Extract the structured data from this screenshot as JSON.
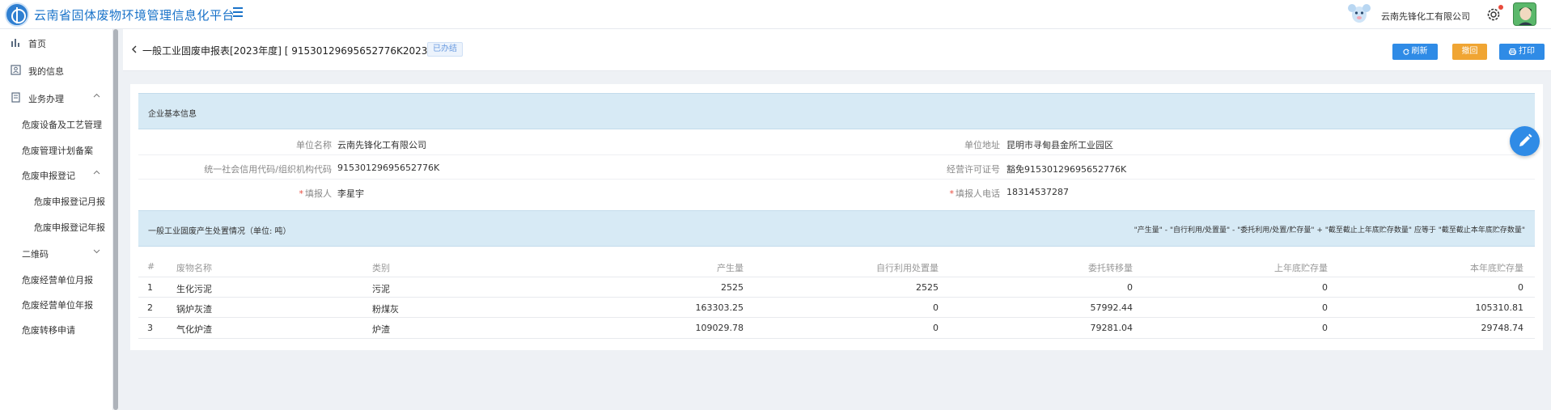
{
  "header": {
    "app_title": "云南省固体废物环境管理信息化平台",
    "company_name": "云南先锋化工有限公司"
  },
  "sidebar": {
    "items": [
      {
        "label": "首页"
      },
      {
        "label": "我的信息"
      },
      {
        "label": "业务办理"
      },
      {
        "label": "危废设备及工艺管理"
      },
      {
        "label": "危废管理计划备案"
      },
      {
        "label": "危废申报登记"
      },
      {
        "label": "危废申报登记月报"
      },
      {
        "label": "危废申报登记年报"
      },
      {
        "label": "二维码"
      },
      {
        "label": "危废经营单位月报"
      },
      {
        "label": "危废经营单位年报"
      },
      {
        "label": "危废转移申请"
      }
    ]
  },
  "page": {
    "title": "一般工业固废申报表[2023年度] [ 91530129695652776K2023 ]",
    "status": "已办结",
    "buttons": {
      "refresh": "刷新",
      "back": "撤回",
      "print": "打印"
    }
  },
  "basic_info": {
    "section_title": "企业基本信息",
    "fields": {
      "unit_name_label": "单位名称",
      "unit_name": "云南先锋化工有限公司",
      "unit_address_label": "单位地址",
      "unit_address": "昆明市寻甸县金所工业园区",
      "credit_code_label": "统一社会信用代码/组织机构代码",
      "credit_code": "91530129695652776K",
      "license_label": "经营许可证号",
      "license": "豁免91530129695652776K",
      "reporter_label": "填报人",
      "reporter": "李星宇",
      "reporter_phone_label": "填报人电话",
      "reporter_phone": "18314537287"
    }
  },
  "waste_section": {
    "title": "一般工业固废产生处置情况（单位: 吨）",
    "note": "\"产生量\" - \"自行利用/处置量\" - \"委托利用/处置/贮存量\" + \"截至截止上年底贮存数量\" 应等于 \"截至截止本年底贮存数量\""
  },
  "table": {
    "headers": [
      "#",
      "废物名称",
      "类别",
      "产生量",
      "自行利用处置量",
      "委托转移量",
      "上年底贮存量",
      "本年底贮存量"
    ],
    "rows": [
      [
        "1",
        "生化污泥",
        "污泥",
        "2525",
        "2525",
        "0",
        "0",
        "0"
      ],
      [
        "2",
        "锅炉灰渣",
        "粉煤灰",
        "163303.25",
        "0",
        "57992.44",
        "0",
        "105310.81"
      ],
      [
        "3",
        "气化炉渣",
        "炉渣",
        "109029.78",
        "0",
        "79281.04",
        "0",
        "29748.74"
      ]
    ]
  }
}
